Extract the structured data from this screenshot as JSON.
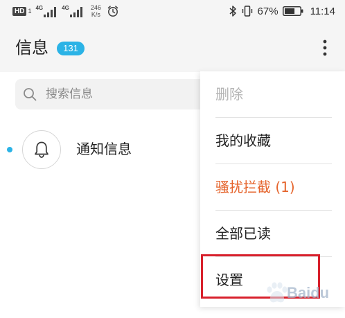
{
  "status_bar": {
    "hd_label": "HD",
    "hd_sim": "1",
    "sim1_network": "4G",
    "sim2_network": "4G",
    "speed_value": "246",
    "speed_unit": "K/s",
    "battery_percent": "67%",
    "battery_level": 0.67,
    "time": "11:14",
    "icons": [
      "hd-icon",
      "signal-icon",
      "alarm-icon",
      "bluetooth-icon",
      "vibrate-icon",
      "battery-icon"
    ]
  },
  "header": {
    "title": "信息",
    "unread_count": "131",
    "more_icon": "more-vertical-icon"
  },
  "search": {
    "placeholder": "搜索信息",
    "icon": "search-icon"
  },
  "conversations": [
    {
      "title": "通知信息",
      "icon": "bell-icon",
      "unread": true
    }
  ],
  "menu": {
    "items": [
      {
        "label": "删除",
        "enabled": false
      },
      {
        "label": "我的收藏",
        "enabled": true
      },
      {
        "label": "骚扰拦截 (1)",
        "enabled": true
      },
      {
        "label": "全部已读",
        "enabled": true
      },
      {
        "label": "设置",
        "enabled": true
      }
    ],
    "highlighted_index": 4
  },
  "watermark": {
    "text": "Baidu"
  },
  "colors": {
    "accent": "#2bb3e6",
    "warning": "#e5642c",
    "highlight": "#d8202c",
    "disabled": "#b4b4b4"
  }
}
